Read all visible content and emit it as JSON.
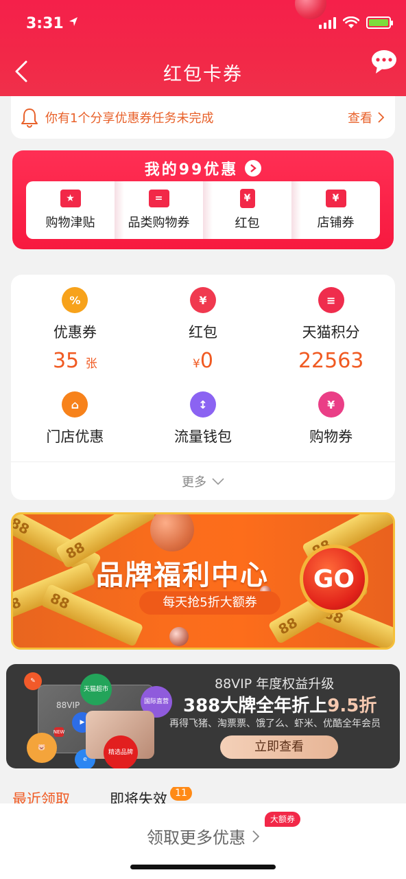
{
  "status": {
    "time": "3:31"
  },
  "header": {
    "title": "红包卡券"
  },
  "notice": {
    "text": "你有1个分享优惠券任务未完成",
    "link": "查看"
  },
  "promo": {
    "title": "我的99优惠",
    "items": [
      {
        "label": "购物津贴",
        "icon": "star-ticket-icon"
      },
      {
        "label": "品类购物券",
        "icon": "equal-ticket-icon"
      },
      {
        "label": "红包",
        "icon": "red-envelope-icon"
      },
      {
        "label": "店铺券",
        "icon": "yen-ticket-icon"
      }
    ]
  },
  "assets": {
    "items": [
      {
        "label": "优惠券",
        "value": "35",
        "unit": "张",
        "color": "#f7a21b",
        "icon": "coupon-icon"
      },
      {
        "label": "红包",
        "prefix": "¥",
        "value": "0",
        "color": "#f0394f",
        "icon": "red-packet-icon"
      },
      {
        "label": "天猫积分",
        "value": "22563",
        "color": "#ef2d4d",
        "icon": "coins-icon"
      },
      {
        "label": "门店优惠",
        "color": "#f7821b",
        "icon": "store-icon"
      },
      {
        "label": "流量钱包",
        "color": "#8b63f2",
        "icon": "data-wallet-icon"
      },
      {
        "label": "购物券",
        "color": "#ea3e86",
        "icon": "shopping-voucher-icon"
      }
    ],
    "more": "更多"
  },
  "banner": {
    "title": "品牌福利中心",
    "subtitle": "每天抢5折大额券",
    "go": "GO",
    "ribbon_text": "88"
  },
  "vip": {
    "card_label": "88VIP",
    "line1": "88VIP 年度权益升级",
    "line2_prefix": "388大牌全年折上",
    "line2_highlight": "9.5折",
    "line3": "再得飞猪、淘票票、饿了么、虾米、优酷全年会员",
    "button": "立即查看",
    "badges": [
      "天猫超市",
      "国际直营",
      "精选品牌",
      "NEW"
    ]
  },
  "tabs": {
    "items": [
      "最近领取",
      "即将失效"
    ],
    "badge": "11"
  },
  "bottom": {
    "label": "领取更多优惠",
    "tag": "大额券"
  },
  "colors": {
    "brand_red": "#f22848",
    "accent_orange": "#f05a22"
  }
}
